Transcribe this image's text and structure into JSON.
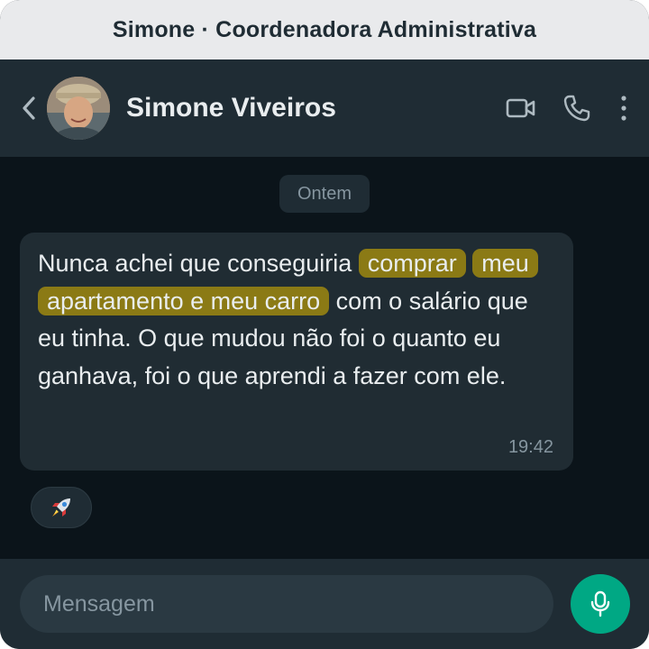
{
  "window": {
    "title": "Simone · Coordenadora Administrativa"
  },
  "header": {
    "contact_name": "Simone Viveiros",
    "icons": [
      "back-chevron-icon",
      "video-call-icon",
      "voice-call-icon",
      "more-options-icon"
    ]
  },
  "chat": {
    "date_separator": "Ontem",
    "message": {
      "text_before": "Nunca achei que conseguiria ",
      "highlight_1": "comprar",
      "highlight_2": "meu apartamento e meu carro",
      "text_after": " com o salário que eu tinha. O que mudou não foi o quanto eu ganhava, foi o que aprendi a fazer com ele.",
      "time": "19:42"
    },
    "reaction": "🚀"
  },
  "composer": {
    "placeholder": "Mensagem"
  },
  "colors": {
    "background": "#0b141a",
    "header": "#1f2c34",
    "bubble": "#202c33",
    "highlight": "#8b7a15",
    "accent": "#00a884"
  }
}
